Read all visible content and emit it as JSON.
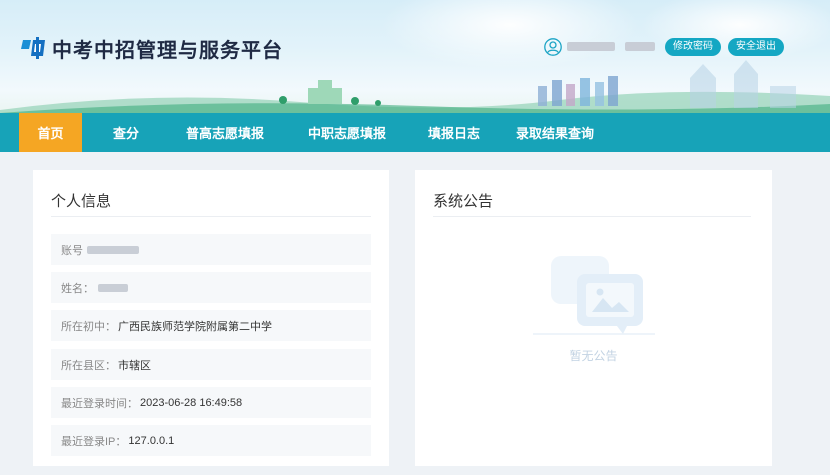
{
  "header": {
    "site_title": "中考中招管理与服务平台",
    "change_password": "修改密码",
    "logout": "安全退出"
  },
  "nav": {
    "items": [
      {
        "label": "首页",
        "active": true
      },
      {
        "label": "查分",
        "active": false
      },
      {
        "label": "普高志愿填报",
        "active": false
      },
      {
        "label": "中职志愿填报",
        "active": false
      },
      {
        "label": "填报日志",
        "active": false
      },
      {
        "label": "录取结果查询",
        "active": false
      }
    ]
  },
  "personal": {
    "title": "个人信息",
    "account_label": "账号",
    "name_label": "姓名：",
    "school_label": "所在初中：",
    "school_value": "广西民族师范学院附属第二中学",
    "county_label": "所在县区：",
    "county_value": "市辖区",
    "last_login_time_label": "最近登录时间：",
    "last_login_time_value": "2023-06-28 16:49:58",
    "last_login_ip_label": "最近登录IP：",
    "last_login_ip_value": "127.0.0.1"
  },
  "notice": {
    "title": "系统公告",
    "empty_text": "暂无公告"
  },
  "colors": {
    "nav_bg": "#17a3b8",
    "nav_active": "#f5a623",
    "button": "#14a7c3",
    "page_bg": "#eef2f6"
  },
  "icons": {
    "logo": "platform-logo-icon",
    "user": "user-icon",
    "empty": "empty-notice-icon"
  }
}
